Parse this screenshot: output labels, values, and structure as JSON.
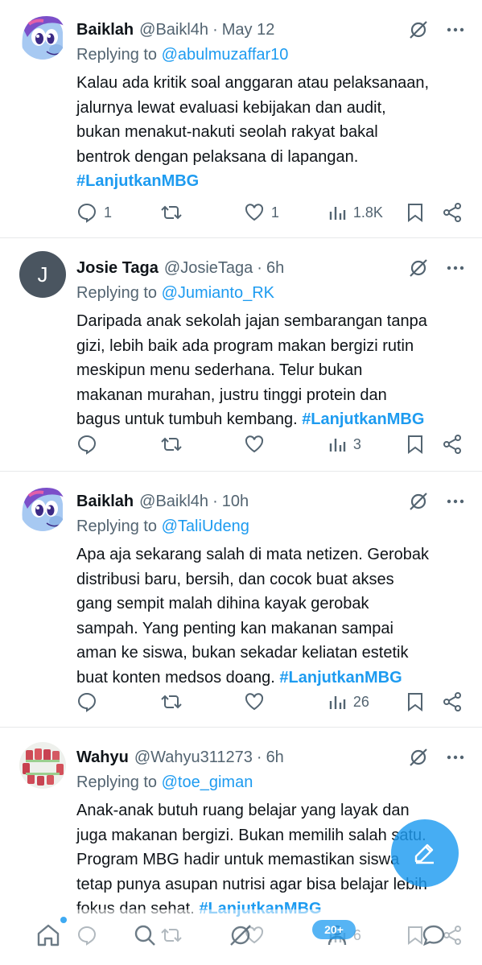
{
  "tweets": [
    {
      "name": "Baiklah",
      "handle": "@Baikl4h",
      "time": "May 12",
      "replying_prefix": "Replying to ",
      "replying_to": "@abulmuzaffar10",
      "lines": [
        "Kalau ada kritik soal anggaran atau pelaksanaan,",
        "jalurnya lewat evaluasi kebijakan dan audit,",
        "bukan menakut-nakuti seolah rakyat bakal",
        "bentrok dengan pelaksana di lapangan."
      ],
      "hashtag": "#LanjutkanMBG",
      "replies": "1",
      "reposts": "",
      "likes": "1",
      "views": "1.8K"
    },
    {
      "name": "Josie Taga",
      "handle": "@JosieTaga",
      "time": "6h",
      "avatar_letter": "J",
      "replying_prefix": "Replying to ",
      "replying_to": "@Jumianto_RK",
      "lines": [
        "Daripada anak sekolah jajan sembarangan tanpa",
        "gizi, lebih baik ada program makan bergizi rutin",
        "meskipun menu sederhana. Telur bukan",
        "makanan murahan, justru tinggi protein dan",
        "bagus untuk tumbuh kembang. "
      ],
      "hashtag": "#LanjutkanMBG",
      "replies": "",
      "reposts": "",
      "likes": "",
      "views": "3"
    },
    {
      "name": "Baiklah",
      "handle": "@Baikl4h",
      "time": "10h",
      "replying_prefix": "Replying to ",
      "replying_to": "@TaliUdeng",
      "lines": [
        "Apa aja sekarang salah di mata netizen. Gerobak",
        "distribusi baru, bersih, dan cocok buat akses",
        "gang sempit malah dihina kayak gerobak",
        "sampah. Yang penting kan makanan sampai",
        "aman ke siswa, bukan sekadar keliatan estetik",
        "buat konten medsos doang. "
      ],
      "hashtag": "#LanjutkanMBG",
      "replies": "",
      "reposts": "",
      "likes": "",
      "views": "26"
    },
    {
      "name": "Wahyu",
      "handle": "@Wahyu311273",
      "time": "6h",
      "replying_prefix": "Replying to ",
      "replying_to": "@toe_giman",
      "lines": [
        "Anak-anak butuh ruang belajar yang layak dan",
        "juga makanan bergizi. Bukan memilih salah satu.",
        "Program MBG hadir untuk memastikan siswa",
        "tetap punya asupan nutrisi agar bisa belajar lebih",
        "fokus dan sehat. "
      ],
      "hashtag": "#LanjutkanMBG",
      "replies": "",
      "reposts": "",
      "likes": "",
      "views": "6"
    }
  ],
  "separator": "·",
  "nav_badge": "20+",
  "colors": {
    "accent": "#1d9bf0",
    "muted": "#536471",
    "text": "#0f1419"
  }
}
